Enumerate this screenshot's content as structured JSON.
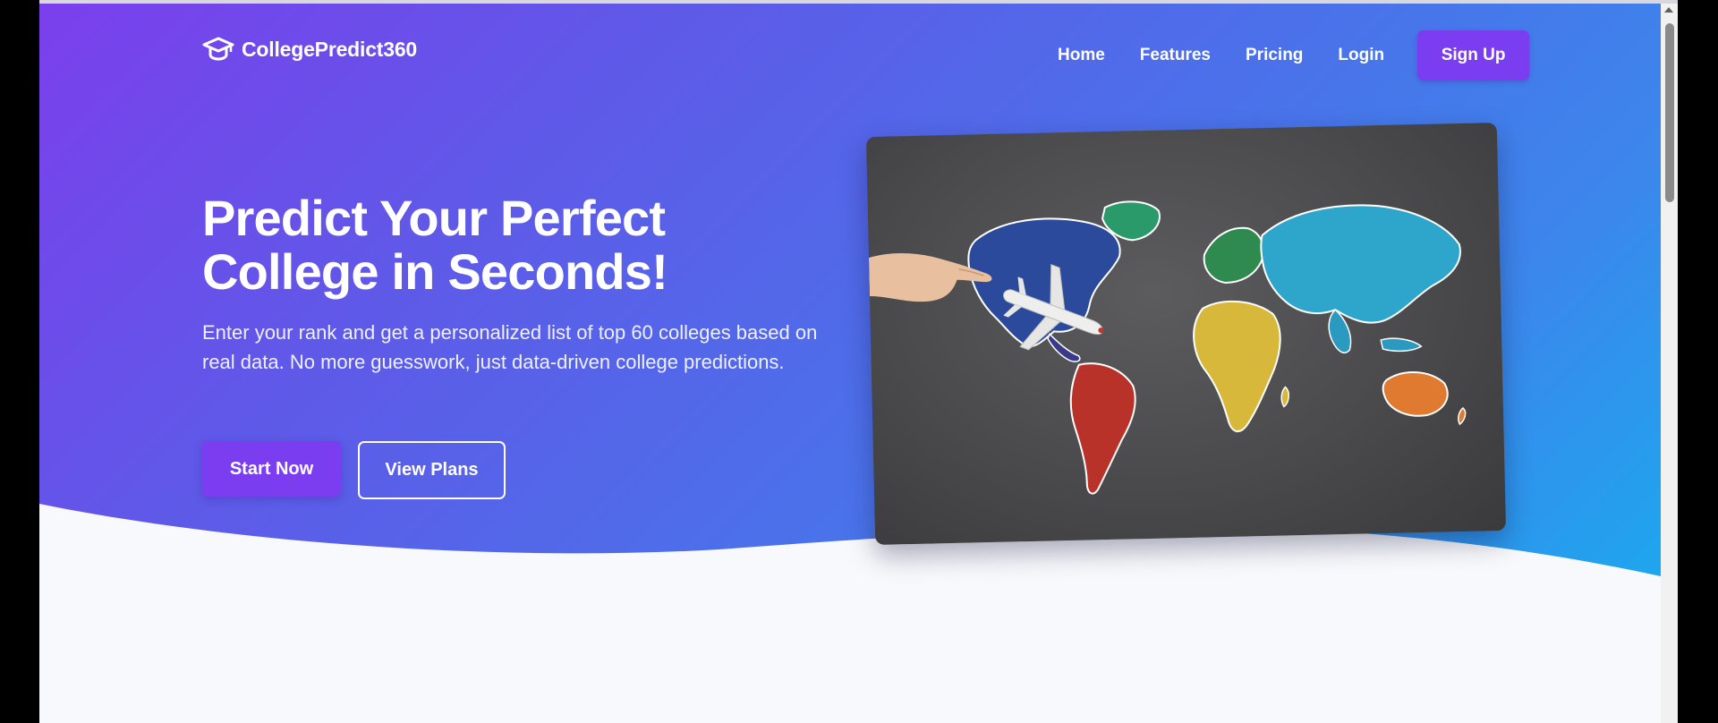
{
  "brand": {
    "name": "CollegePredict360",
    "icon": "graduation-cap-icon"
  },
  "nav": {
    "links": [
      "Home",
      "Features",
      "Pricing",
      "Login"
    ],
    "signup_label": "Sign Up"
  },
  "hero": {
    "headline_line1": "Predict Your Perfect",
    "headline_line2": "College in Seconds!",
    "subtext": "Enter your rank and get a personalized list of top 60 colleges based on real data. No more guesswork, just data-driven college predictions.",
    "primary_button": "Start Now",
    "secondary_button": "View Plans",
    "image": "world-map-chalkboard-with-toy-airplane"
  },
  "colors": {
    "gradient_start": "#7b3fec",
    "gradient_end": "#1ea6ee",
    "accent_button": "#7a3df0",
    "page_background": "#f8f9fc"
  }
}
